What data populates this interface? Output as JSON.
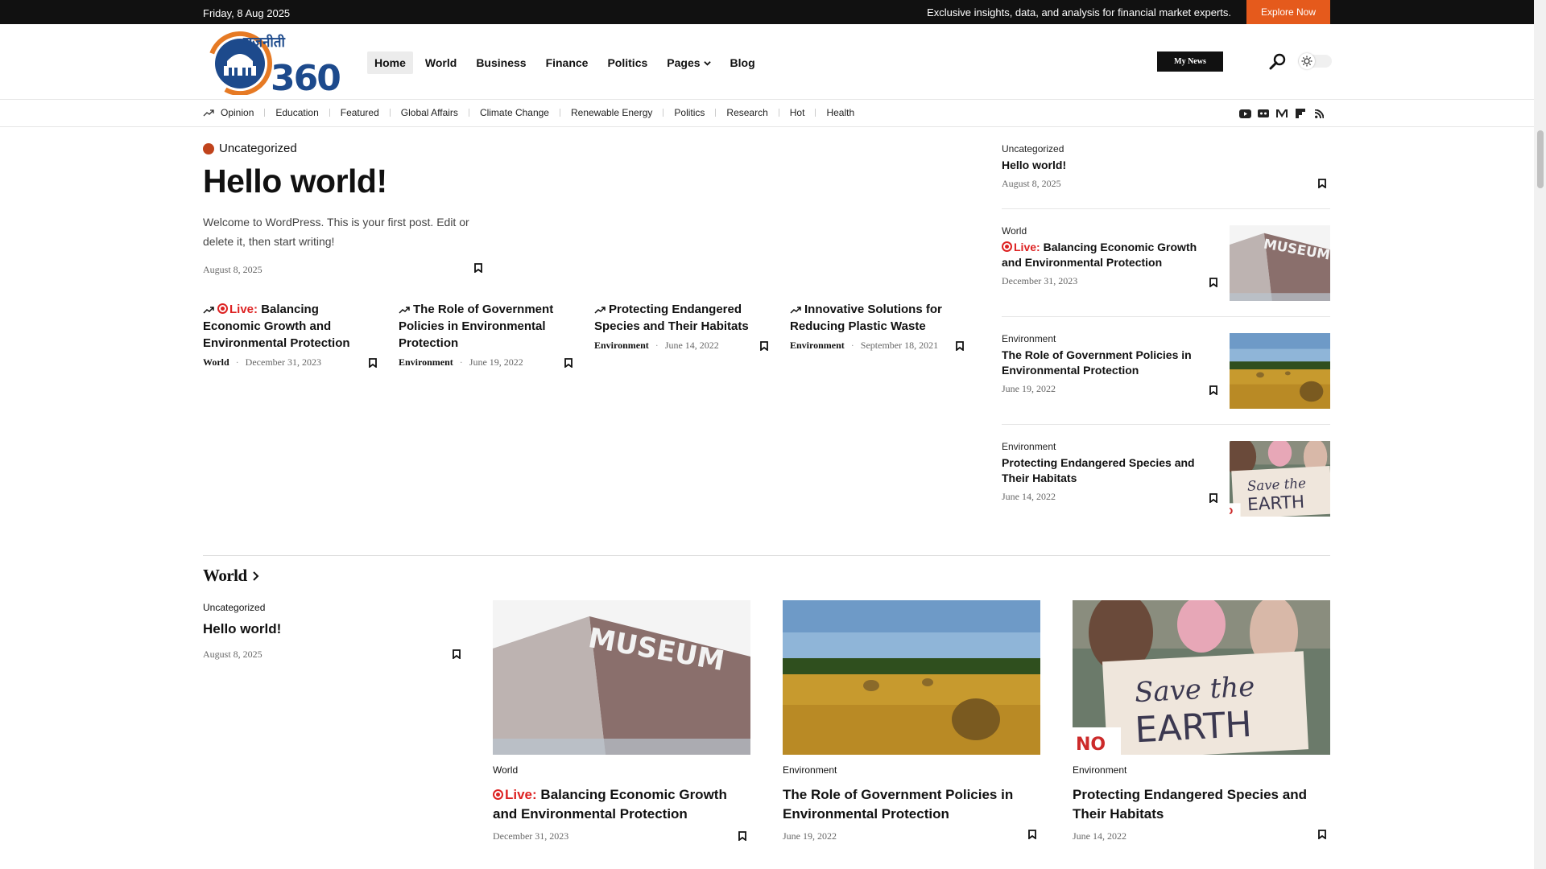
{
  "topbar": {
    "date": "Friday, 8 Aug 2025",
    "tagline": "Exclusive insights, data, and analysis for financial market experts.",
    "explore_label": "Explore Now"
  },
  "header": {
    "logo_text": "राजनीती",
    "logo_number": "360",
    "nav": [
      {
        "label": "Home"
      },
      {
        "label": "World"
      },
      {
        "label": "Business"
      },
      {
        "label": "Finance"
      },
      {
        "label": "Politics"
      },
      {
        "label": "Pages"
      },
      {
        "label": "Blog"
      }
    ],
    "my_news_label": "My News"
  },
  "categories": [
    "Opinion",
    "Education",
    "Featured",
    "Global Affairs",
    "Climate Change",
    "Renewable Energy",
    "Politics",
    "Research",
    "Hot",
    "Health"
  ],
  "social_icons": [
    "youtube-icon",
    "reddit-icon",
    "medium-icon",
    "flipboard-icon",
    "rss-icon"
  ],
  "hero": {
    "category": "Uncategorized",
    "title": "Hello world!",
    "excerpt": "Welcome to WordPress. This is your first post. Edit or delete it, then start writing!",
    "date": "August 8, 2025"
  },
  "live_label": "Live:",
  "small_posts": [
    {
      "title": "Balancing Economic Growth and Environmental Protection",
      "live": true,
      "category": "World",
      "date": "December 31, 2023"
    },
    {
      "title": "The Role of Government Policies in Environmental Protection",
      "live": false,
      "category": "Environment",
      "date": "June 19, 2022"
    },
    {
      "title": "Protecting Endangered Species and Their Habitats",
      "live": false,
      "category": "Environment",
      "date": "June 14, 2022"
    },
    {
      "title": "Innovative Solutions for Reducing Plastic Waste",
      "live": false,
      "category": "Environment",
      "date": "September 18, 2021"
    }
  ],
  "sidebar_posts": [
    {
      "category": "Uncategorized",
      "title": "Hello world!",
      "date": "August 8, 2025"
    },
    {
      "category": "World",
      "title": "Balancing Economic Growth and Environmental Protection",
      "live": true,
      "date": "December 31, 2023",
      "image": "museum"
    },
    {
      "category": "Environment",
      "title": "The Role of Government Policies in Environmental Protection",
      "date": "June 19, 2022",
      "image": "field"
    },
    {
      "category": "Environment",
      "title": "Protecting Endangered Species and Their Habitats",
      "date": "June 14, 2022",
      "image": "earth-sign"
    }
  ],
  "world_section": {
    "heading": "World",
    "first": {
      "category": "Uncategorized",
      "title": "Hello world!",
      "date": "August 8, 2025"
    },
    "cards": [
      {
        "category": "World",
        "title": "Balancing Economic Growth and Environmental Protection",
        "live": true,
        "date": "December 31, 2023",
        "image": "museum"
      },
      {
        "category": "Environment",
        "title": "The Role of Government Policies in Environmental Protection",
        "date": "June 19, 2022",
        "image": "field"
      },
      {
        "category": "Environment",
        "title": "Protecting Endangered Species and Their Habitats",
        "date": "June 14, 2022",
        "image": "earth-sign"
      }
    ]
  },
  "image_text": {
    "museum": "MUSEUM",
    "earth_line1": "Save the",
    "earth_line2": "EARTH",
    "earth_no": "NO"
  },
  "colors": {
    "accent": "#e55a1c",
    "live": "#dd2222",
    "topbar": "#111111",
    "hero_dot": "#c0431c"
  }
}
